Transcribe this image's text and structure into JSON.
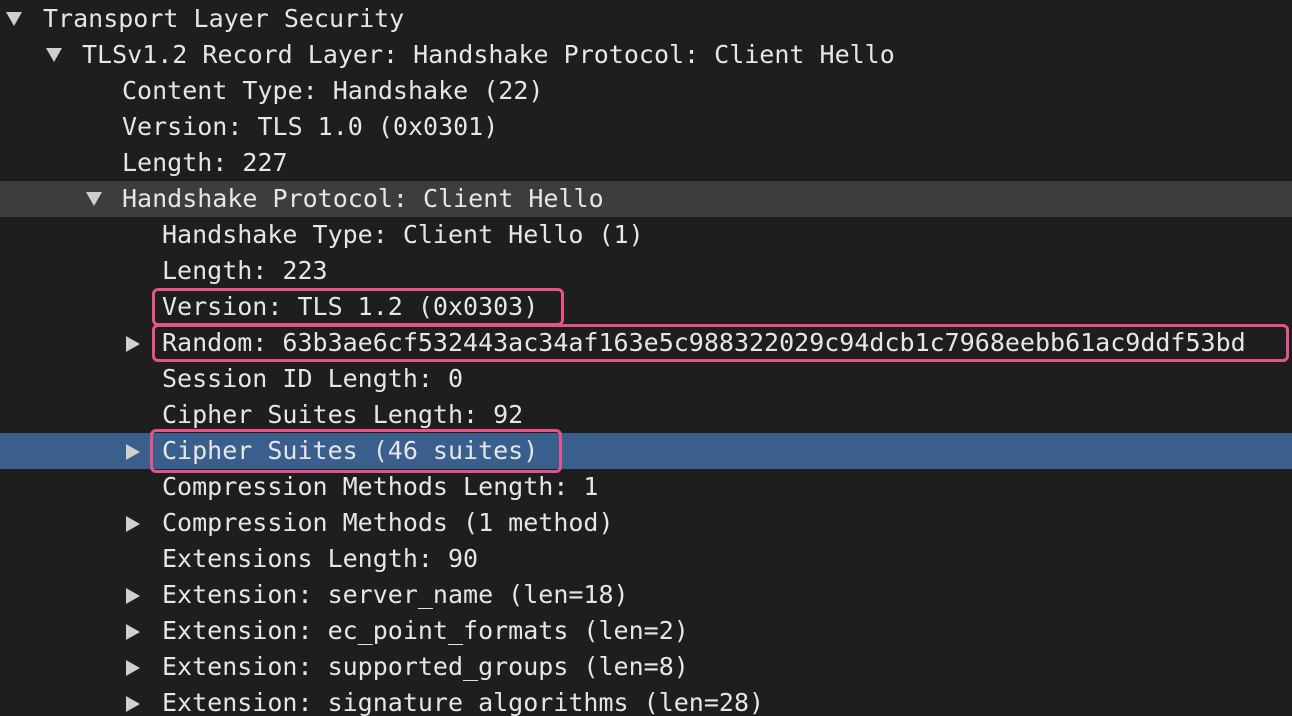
{
  "tree": {
    "rows": [
      {
        "label": "Transport Layer Security",
        "expander": "expanded"
      },
      {
        "label": "TLSv1.2 Record Layer: Handshake Protocol: Client Hello",
        "expander": "expanded"
      },
      {
        "label": "Content Type: Handshake (22)",
        "expander": "none"
      },
      {
        "label": "Version: TLS 1.0 (0x0301)",
        "expander": "none"
      },
      {
        "label": "Length: 227",
        "expander": "none"
      },
      {
        "label": "Handshake Protocol: Client Hello",
        "expander": "expanded"
      },
      {
        "label": "Handshake Type: Client Hello (1)",
        "expander": "none"
      },
      {
        "label": "Length: 223",
        "expander": "none"
      },
      {
        "label": "Version: TLS 1.2 (0x0303)",
        "expander": "none",
        "highlighted": true
      },
      {
        "label": "Random: 63b3ae6cf532443ac34af163e5c988322029c94dcb1c7968eebb61ac9ddf53bd",
        "expander": "collapsed",
        "highlighted": true
      },
      {
        "label": "Session ID Length: 0",
        "expander": "none"
      },
      {
        "label": "Cipher Suites Length: 92",
        "expander": "none"
      },
      {
        "label": "Cipher Suites (46 suites)",
        "expander": "collapsed",
        "highlighted": true,
        "selected": true
      },
      {
        "label": "Compression Methods Length: 1",
        "expander": "none"
      },
      {
        "label": "Compression Methods (1 method)",
        "expander": "collapsed"
      },
      {
        "label": "Extensions Length: 90",
        "expander": "none"
      },
      {
        "label": "Extension: server_name (len=18)",
        "expander": "collapsed"
      },
      {
        "label": "Extension: ec_point_formats (len=2)",
        "expander": "collapsed"
      },
      {
        "label": "Extension: supported_groups (len=8)",
        "expander": "collapsed"
      },
      {
        "label": "Extension: signature_algorithms (len=28)",
        "expander": "collapsed"
      }
    ]
  },
  "colors": {
    "background": "#1e1e1e",
    "text": "#e6e6e6",
    "selected_row": "#3b5f8c",
    "hover_row": "#3d3d3d",
    "annotation_box": "#e5538c",
    "arrow": "#cfcfcf"
  }
}
